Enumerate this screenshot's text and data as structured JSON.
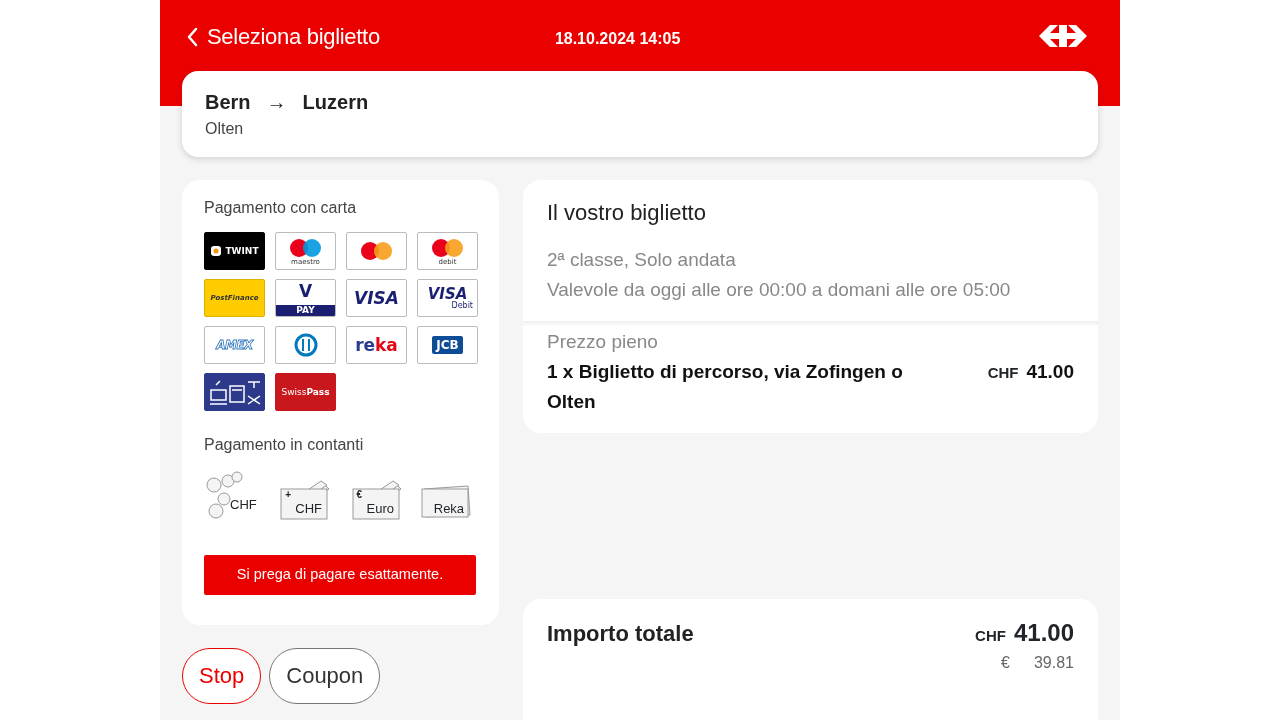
{
  "header": {
    "title": "Seleziona biglietto",
    "datetime": "18.10.2024 14:05"
  },
  "route": {
    "from": "Bern",
    "arrow": "→",
    "to": "Luzern",
    "via": "Olten"
  },
  "payment": {
    "card_title": "Pagamento con carta",
    "cards": [
      {
        "kind": "twint",
        "label": "TWINT"
      },
      {
        "kind": "maestro",
        "label": "maestro"
      },
      {
        "kind": "mastercard"
      },
      {
        "kind": "debit",
        "label": "debit"
      },
      {
        "kind": "postfinance",
        "label": "PostFinance"
      },
      {
        "kind": "vpay",
        "label": "V",
        "sub": "PAY"
      },
      {
        "kind": "visa",
        "label": "VISA"
      },
      {
        "kind": "visadebit",
        "label": "VISA",
        "sub": "Debit"
      },
      {
        "kind": "amex",
        "label": "AMEX"
      },
      {
        "kind": "diners"
      },
      {
        "kind": "reka",
        "label": "re",
        "sub": "ka"
      },
      {
        "kind": "jcb",
        "label": "JCB"
      },
      {
        "kind": "transit"
      },
      {
        "kind": "swisspass",
        "label": "Swiss",
        "sub": "Pass"
      }
    ],
    "cash_title": "Pagamento in contanti",
    "cash": [
      {
        "kind": "coins",
        "label": "CHF"
      },
      {
        "kind": "notes",
        "label": "CHF",
        "sign": "+"
      },
      {
        "kind": "notes",
        "label": "Euro",
        "sign": "€"
      },
      {
        "kind": "voucher",
        "label": "Reka"
      }
    ],
    "notice": "Si prega di pagare esattamente."
  },
  "buttons": [
    {
      "kind": "stop",
      "label": "Stop"
    },
    {
      "kind": "plain",
      "label": "Coupon"
    }
  ],
  "ticket": {
    "title": "Il vostro biglietto",
    "class_line": "2ª classe, Solo andata",
    "validity": "Valevole da oggi alle ore 00:00 a domani alle ore 05:00",
    "fare_type": "Prezzo pieno",
    "item": "1 x Biglietto di percorso, via Zofingen o Olten",
    "currency": "CHF",
    "price": "41.00"
  },
  "total": {
    "label": "Importo totale",
    "currency": "CHF",
    "amount": "41.00",
    "alt_currency": "€",
    "alt_amount": "39.81"
  }
}
